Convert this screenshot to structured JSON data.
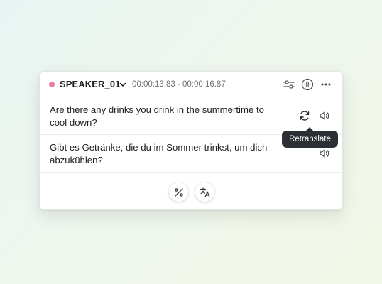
{
  "segment": {
    "speaker_name": "SPEAKER_01",
    "speaker_color": "#ee7aa4",
    "time_range": "00:00:13.83 - 00:00:16.87"
  },
  "header_icons": [
    "sliders-icon",
    "waveform-icon",
    "more-icon"
  ],
  "rows": [
    {
      "text": "Are there any drinks you drink in the summertime to cool down?",
      "icons": [
        "retranslate-icon",
        "speaker-volume-icon"
      ]
    },
    {
      "text": "Gibt es Getränke, die du im Sommer trinkst, um dich abzukühlen?",
      "icons": [
        "speaker-volume-icon"
      ]
    }
  ],
  "bottom_actions": [
    "percent-icon",
    "translate-icon"
  ],
  "tooltip": {
    "label": "Retranslate"
  }
}
